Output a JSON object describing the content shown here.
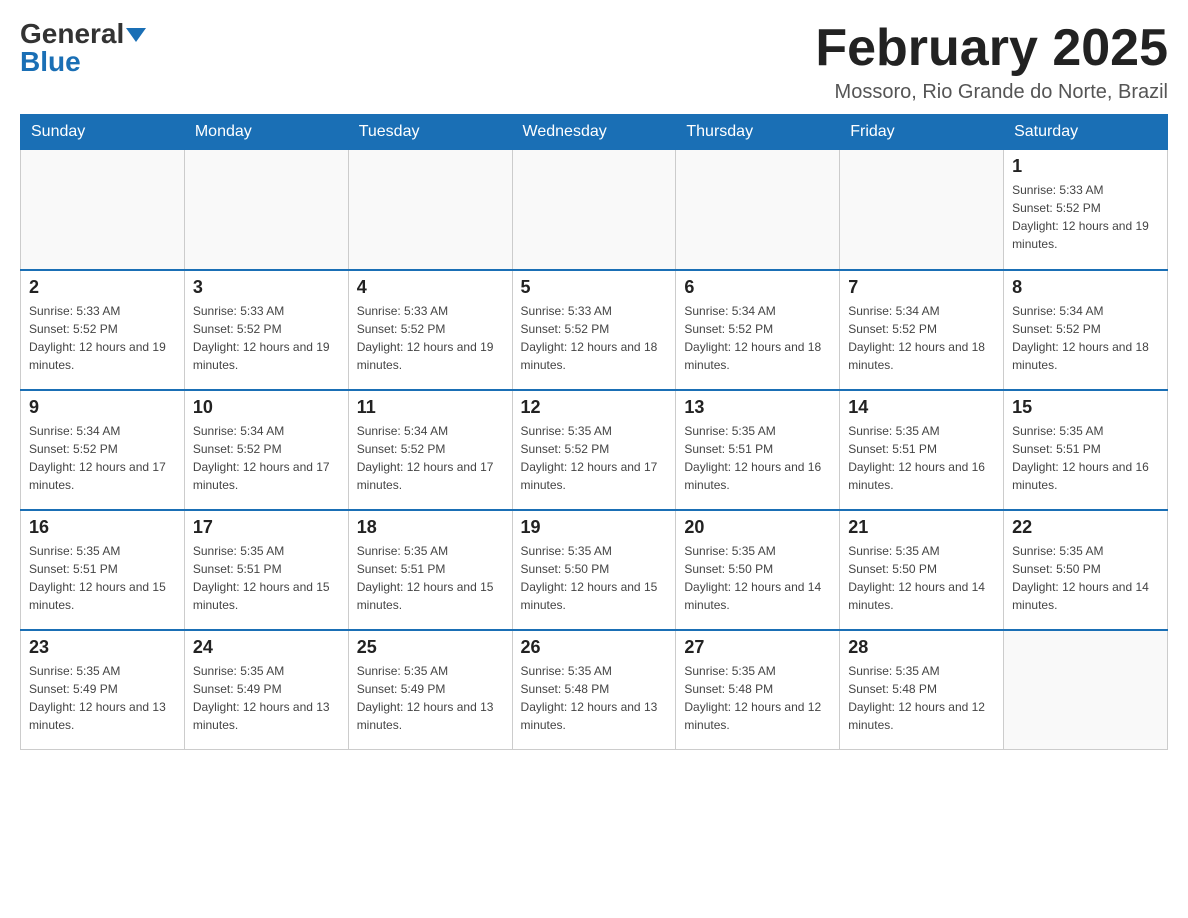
{
  "header": {
    "logo_general": "General",
    "logo_blue": "Blue",
    "title": "February 2025",
    "subtitle": "Mossoro, Rio Grande do Norte, Brazil"
  },
  "days_of_week": [
    "Sunday",
    "Monday",
    "Tuesday",
    "Wednesday",
    "Thursday",
    "Friday",
    "Saturday"
  ],
  "weeks": [
    [
      {
        "day": "",
        "info": ""
      },
      {
        "day": "",
        "info": ""
      },
      {
        "day": "",
        "info": ""
      },
      {
        "day": "",
        "info": ""
      },
      {
        "day": "",
        "info": ""
      },
      {
        "day": "",
        "info": ""
      },
      {
        "day": "1",
        "info": "Sunrise: 5:33 AM\nSunset: 5:52 PM\nDaylight: 12 hours and 19 minutes."
      }
    ],
    [
      {
        "day": "2",
        "info": "Sunrise: 5:33 AM\nSunset: 5:52 PM\nDaylight: 12 hours and 19 minutes."
      },
      {
        "day": "3",
        "info": "Sunrise: 5:33 AM\nSunset: 5:52 PM\nDaylight: 12 hours and 19 minutes."
      },
      {
        "day": "4",
        "info": "Sunrise: 5:33 AM\nSunset: 5:52 PM\nDaylight: 12 hours and 19 minutes."
      },
      {
        "day": "5",
        "info": "Sunrise: 5:33 AM\nSunset: 5:52 PM\nDaylight: 12 hours and 18 minutes."
      },
      {
        "day": "6",
        "info": "Sunrise: 5:34 AM\nSunset: 5:52 PM\nDaylight: 12 hours and 18 minutes."
      },
      {
        "day": "7",
        "info": "Sunrise: 5:34 AM\nSunset: 5:52 PM\nDaylight: 12 hours and 18 minutes."
      },
      {
        "day": "8",
        "info": "Sunrise: 5:34 AM\nSunset: 5:52 PM\nDaylight: 12 hours and 18 minutes."
      }
    ],
    [
      {
        "day": "9",
        "info": "Sunrise: 5:34 AM\nSunset: 5:52 PM\nDaylight: 12 hours and 17 minutes."
      },
      {
        "day": "10",
        "info": "Sunrise: 5:34 AM\nSunset: 5:52 PM\nDaylight: 12 hours and 17 minutes."
      },
      {
        "day": "11",
        "info": "Sunrise: 5:34 AM\nSunset: 5:52 PM\nDaylight: 12 hours and 17 minutes."
      },
      {
        "day": "12",
        "info": "Sunrise: 5:35 AM\nSunset: 5:52 PM\nDaylight: 12 hours and 17 minutes."
      },
      {
        "day": "13",
        "info": "Sunrise: 5:35 AM\nSunset: 5:51 PM\nDaylight: 12 hours and 16 minutes."
      },
      {
        "day": "14",
        "info": "Sunrise: 5:35 AM\nSunset: 5:51 PM\nDaylight: 12 hours and 16 minutes."
      },
      {
        "day": "15",
        "info": "Sunrise: 5:35 AM\nSunset: 5:51 PM\nDaylight: 12 hours and 16 minutes."
      }
    ],
    [
      {
        "day": "16",
        "info": "Sunrise: 5:35 AM\nSunset: 5:51 PM\nDaylight: 12 hours and 15 minutes."
      },
      {
        "day": "17",
        "info": "Sunrise: 5:35 AM\nSunset: 5:51 PM\nDaylight: 12 hours and 15 minutes."
      },
      {
        "day": "18",
        "info": "Sunrise: 5:35 AM\nSunset: 5:51 PM\nDaylight: 12 hours and 15 minutes."
      },
      {
        "day": "19",
        "info": "Sunrise: 5:35 AM\nSunset: 5:50 PM\nDaylight: 12 hours and 15 minutes."
      },
      {
        "day": "20",
        "info": "Sunrise: 5:35 AM\nSunset: 5:50 PM\nDaylight: 12 hours and 14 minutes."
      },
      {
        "day": "21",
        "info": "Sunrise: 5:35 AM\nSunset: 5:50 PM\nDaylight: 12 hours and 14 minutes."
      },
      {
        "day": "22",
        "info": "Sunrise: 5:35 AM\nSunset: 5:50 PM\nDaylight: 12 hours and 14 minutes."
      }
    ],
    [
      {
        "day": "23",
        "info": "Sunrise: 5:35 AM\nSunset: 5:49 PM\nDaylight: 12 hours and 13 minutes."
      },
      {
        "day": "24",
        "info": "Sunrise: 5:35 AM\nSunset: 5:49 PM\nDaylight: 12 hours and 13 minutes."
      },
      {
        "day": "25",
        "info": "Sunrise: 5:35 AM\nSunset: 5:49 PM\nDaylight: 12 hours and 13 minutes."
      },
      {
        "day": "26",
        "info": "Sunrise: 5:35 AM\nSunset: 5:48 PM\nDaylight: 12 hours and 13 minutes."
      },
      {
        "day": "27",
        "info": "Sunrise: 5:35 AM\nSunset: 5:48 PM\nDaylight: 12 hours and 12 minutes."
      },
      {
        "day": "28",
        "info": "Sunrise: 5:35 AM\nSunset: 5:48 PM\nDaylight: 12 hours and 12 minutes."
      },
      {
        "day": "",
        "info": ""
      }
    ]
  ]
}
